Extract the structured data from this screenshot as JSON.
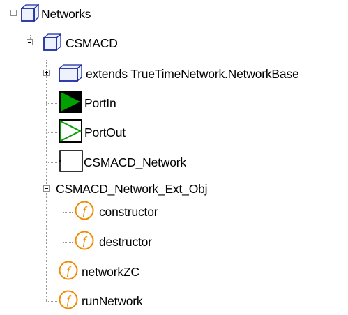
{
  "tree": {
    "items": [
      {
        "label": "Networks",
        "icon": "package-icon"
      },
      {
        "label": "CSMACD",
        "icon": "package-icon"
      },
      {
        "label": "extends TrueTimeNetwork.NetworkBase",
        "icon": "package-icon"
      },
      {
        "label": "PortIn",
        "icon": "port-in-icon"
      },
      {
        "label": "PortOut",
        "icon": "port-out-icon"
      },
      {
        "label": "CSMACD_Network",
        "icon": "block-icon"
      },
      {
        "label": "CSMACD_Network_Ext_Obj",
        "icon": "none"
      },
      {
        "label": "constructor",
        "icon": "function-icon"
      },
      {
        "label": "destructor",
        "icon": "function-icon"
      },
      {
        "label": "networkZC",
        "icon": "function-icon"
      },
      {
        "label": "runNetwork",
        "icon": "function-icon"
      }
    ]
  },
  "colors": {
    "package_outline": "#1a2aa0",
    "package_fill": "#eef2ff",
    "function_circle": "#f08a00"
  }
}
